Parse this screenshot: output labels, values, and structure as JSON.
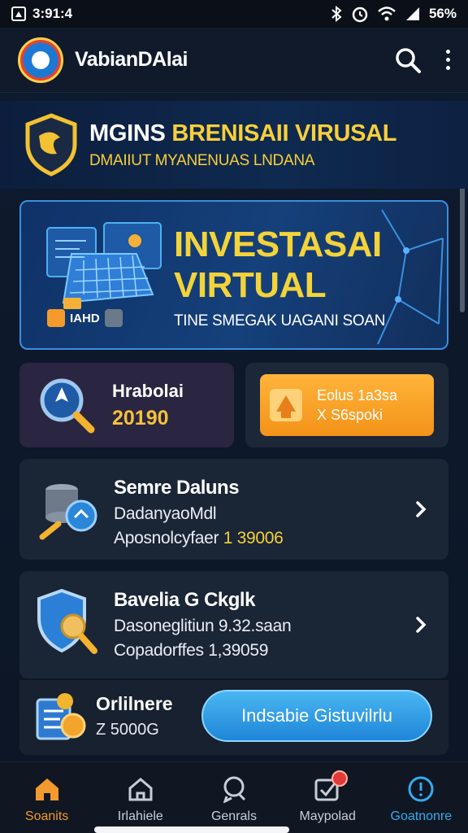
{
  "status_bar": {
    "time": "3:91:4",
    "battery": "56%"
  },
  "app_bar": {
    "title": "VabianDAlai"
  },
  "hero": {
    "title_white": "MGINS",
    "title_yellow": "BRENISAII VIRUSAL",
    "subtitle": "DMAIIUT MYANENUAS LNDANA"
  },
  "banner": {
    "title_line1": "INVESTASAI",
    "title_line2": "VIRTUAL",
    "subtitle": "TINE SMEGAK UAGANI SOAN",
    "tag": "IAHD"
  },
  "card_balance": {
    "label": "Hrabolai",
    "value": "20190"
  },
  "card_bonus": {
    "line1": "Eolus 1a3sa",
    "line2": "X S6spoki"
  },
  "rows": [
    {
      "title": "Semre Daluns",
      "line2": "DadanyaoMdl",
      "line3_prefix": "Aposnolcyfaer",
      "line3_value": "1 39006"
    },
    {
      "title": "Bavelia G Ckglk",
      "line2": "Dasoneglitiun 9.32.saan",
      "line3_prefix": "Copadorffes",
      "line3_value": "1,39059"
    }
  ],
  "promo": {
    "title": "Orlilnere",
    "value": "Z 5000G",
    "cta": "Indsabie Gistuvilrlu"
  },
  "bottom_nav": [
    {
      "label": "Soanits",
      "icon": "home-icon"
    },
    {
      "label": "Irlahiele",
      "icon": "house-icon"
    },
    {
      "label": "Genrals",
      "icon": "chat-icon"
    },
    {
      "label": "Maypolad",
      "icon": "checkbox-icon"
    },
    {
      "label": "Goatnonre",
      "icon": "clock-icon"
    }
  ],
  "colors": {
    "accent_yellow": "#f5c23a",
    "accent_blue": "#36a9ef",
    "accent_orange": "#f29a2e",
    "bg": "#0b1424"
  }
}
